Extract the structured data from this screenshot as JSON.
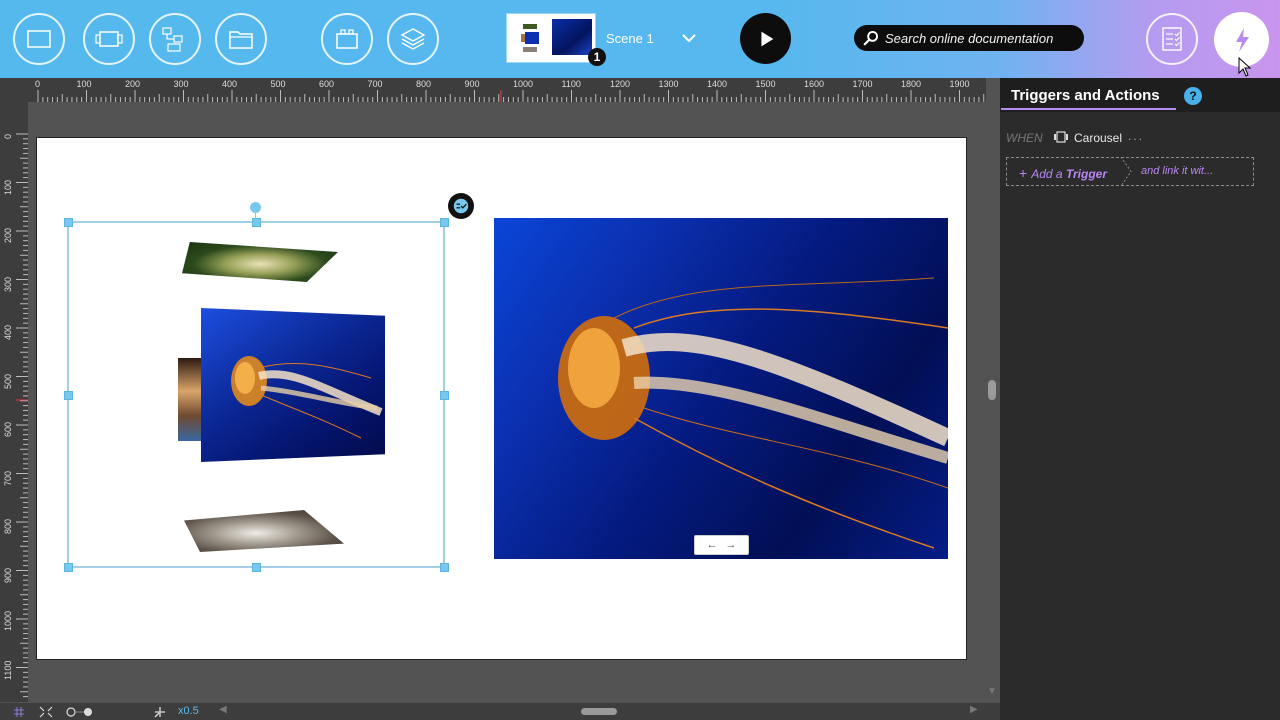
{
  "toolbar": {
    "buttons": [
      {
        "name": "rectangle-tool",
        "icon": "rectangle-icon"
      },
      {
        "name": "widget-tool",
        "icon": "widget-icon"
      },
      {
        "name": "connector-tool",
        "icon": "diagram-icon"
      },
      {
        "name": "folder-tool",
        "icon": "folder-icon"
      },
      {
        "name": "component-tool",
        "icon": "component-icon"
      },
      {
        "name": "layers-tool",
        "icon": "layers-icon"
      }
    ],
    "scene_label": "Scene 1",
    "scene_badge": "1",
    "search_placeholder": "Search online documentation",
    "accent_gradient": [
      "#55b9ee",
      "#c995ee"
    ]
  },
  "rulers": {
    "top": [
      "0",
      "100",
      "200",
      "300",
      "400",
      "500",
      "600",
      "700",
      "800",
      "900",
      "1000",
      "1100",
      "1200",
      "1300",
      "1400",
      "1500",
      "1600",
      "1700",
      "1800",
      "1900"
    ],
    "left": [
      "0",
      "100",
      "200",
      "300",
      "400",
      "500",
      "600",
      "700",
      "800",
      "900",
      "1000",
      "1100"
    ]
  },
  "canvas": {
    "nav_prev": "←",
    "nav_next": "→"
  },
  "statusbar": {
    "zoom": "x0.5"
  },
  "panel": {
    "title": "Triggers and Actions",
    "help": "?",
    "when_label": "WHEN",
    "when_target": "Carousel",
    "when_more": "...",
    "add_trigger_prefix": "Add a ",
    "add_trigger_bold": "Trigger",
    "link_text": "and link it wit...",
    "accent_color": "#b987f5"
  }
}
